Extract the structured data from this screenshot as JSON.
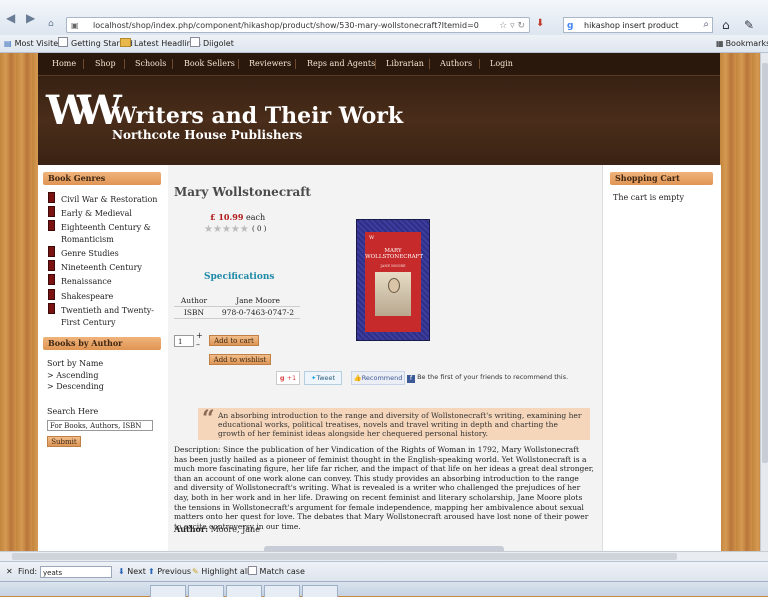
{
  "browser": {
    "url": "localhost/shop/index.php/component/hikashop/product/show/530-mary-wollstonecraft?Itemid=0",
    "search_engine": "g",
    "search_text": "hikashop insert product alignment",
    "bookmarks": [
      "Most Visited",
      "Getting Started",
      "Latest Headlines",
      "Diigolet"
    ],
    "bookmarks_menu": "Bookmarks"
  },
  "site": {
    "menu": [
      "Home",
      "Shop",
      "Schools",
      "Book Sellers",
      "Reviewers",
      "Reps and Agents",
      "Librarian",
      "Authors",
      "Login"
    ],
    "logo": "WW",
    "title": "Writers and Their Work",
    "subtitle": "Northcote House Publishers"
  },
  "left": {
    "genres_title": "Book Genres",
    "genres": [
      "Civil War & Restoration",
      "Early & Medieval",
      "Eighteenth Century & Romanticism",
      "Genre Studies",
      "Nineteenth Century",
      "Renaissance",
      "Shakespeare",
      "Twentieth and Twenty-First Century"
    ],
    "by_author_title": "Books by Author",
    "sort_label": "Sort by Name",
    "sort_asc": "> Ascending",
    "sort_desc": "> Descending",
    "search_label": "Search Here",
    "search_value": "For Books, Authors, ISBN",
    "submit": "Submit"
  },
  "product": {
    "title": "Mary Wollstonecraft",
    "price": "£ 10.99",
    "price_unit": "each",
    "rating": 0,
    "votes": "( 0 )",
    "specs_title": "Specifications",
    "specs": [
      {
        "k": "Author",
        "v": "Jane Moore"
      },
      {
        "k": "ISBN",
        "v": "978-0-7463-0747-2"
      }
    ],
    "qty": "1",
    "add_to_cart": "Add to cart",
    "add_to_wishlist": "Add to wishlist",
    "cover_title": "MARY WOLLSTONECRAFT",
    "cover_author": "JANE MOORE",
    "cover_logo": "W",
    "social": {
      "gplus": "+1",
      "tweet": "Tweet",
      "recommend": "Recommend",
      "fb_text": "Be the first of your friends to recommend this."
    },
    "quote": "An absorbing introduction to the range and diversity of Wollstonecraft's writing, examining her educational works, political treatises, novels and travel writing in depth and charting the growth of her feminist ideas alongside her chequered personal history.",
    "description": "Description: Since the publication of her Vindication of the Rights of Woman in 1792, Mary Wollstonecraft has been justly hailed as a pioneer of feminist thought in the English-speaking world. Yet Wollstonecraft is a much more fascinating figure, her life far richer, and the impact of that life on her ideas a great deal stronger, than an account of one work alone can convey. This study provides an absorbing introduction to the range and diversity of Wollstonecraft's writing. What is revealed is a writer who challenged the prejudices of her day, both in her work and in her life. Drawing on recent feminist and literary scholarship, Jane Moore plots the tensions in Wollstonecraft's argument for female independence, mapping her ambivalence about sexual matters onto her quest for love. The debates that Mary Wollstonecraft aroused have lost none of their power to excite controversy in our time.",
    "author_label": "Author:",
    "author_value": "Moore, Jane"
  },
  "right": {
    "cart_title": "Shopping Cart",
    "cart_empty": "The cart is empty"
  },
  "findbar": {
    "label": "Find:",
    "value": "yeats",
    "next": "Next",
    "previous": "Previous",
    "highlight": "Highlight all",
    "match_case": "Match case"
  }
}
